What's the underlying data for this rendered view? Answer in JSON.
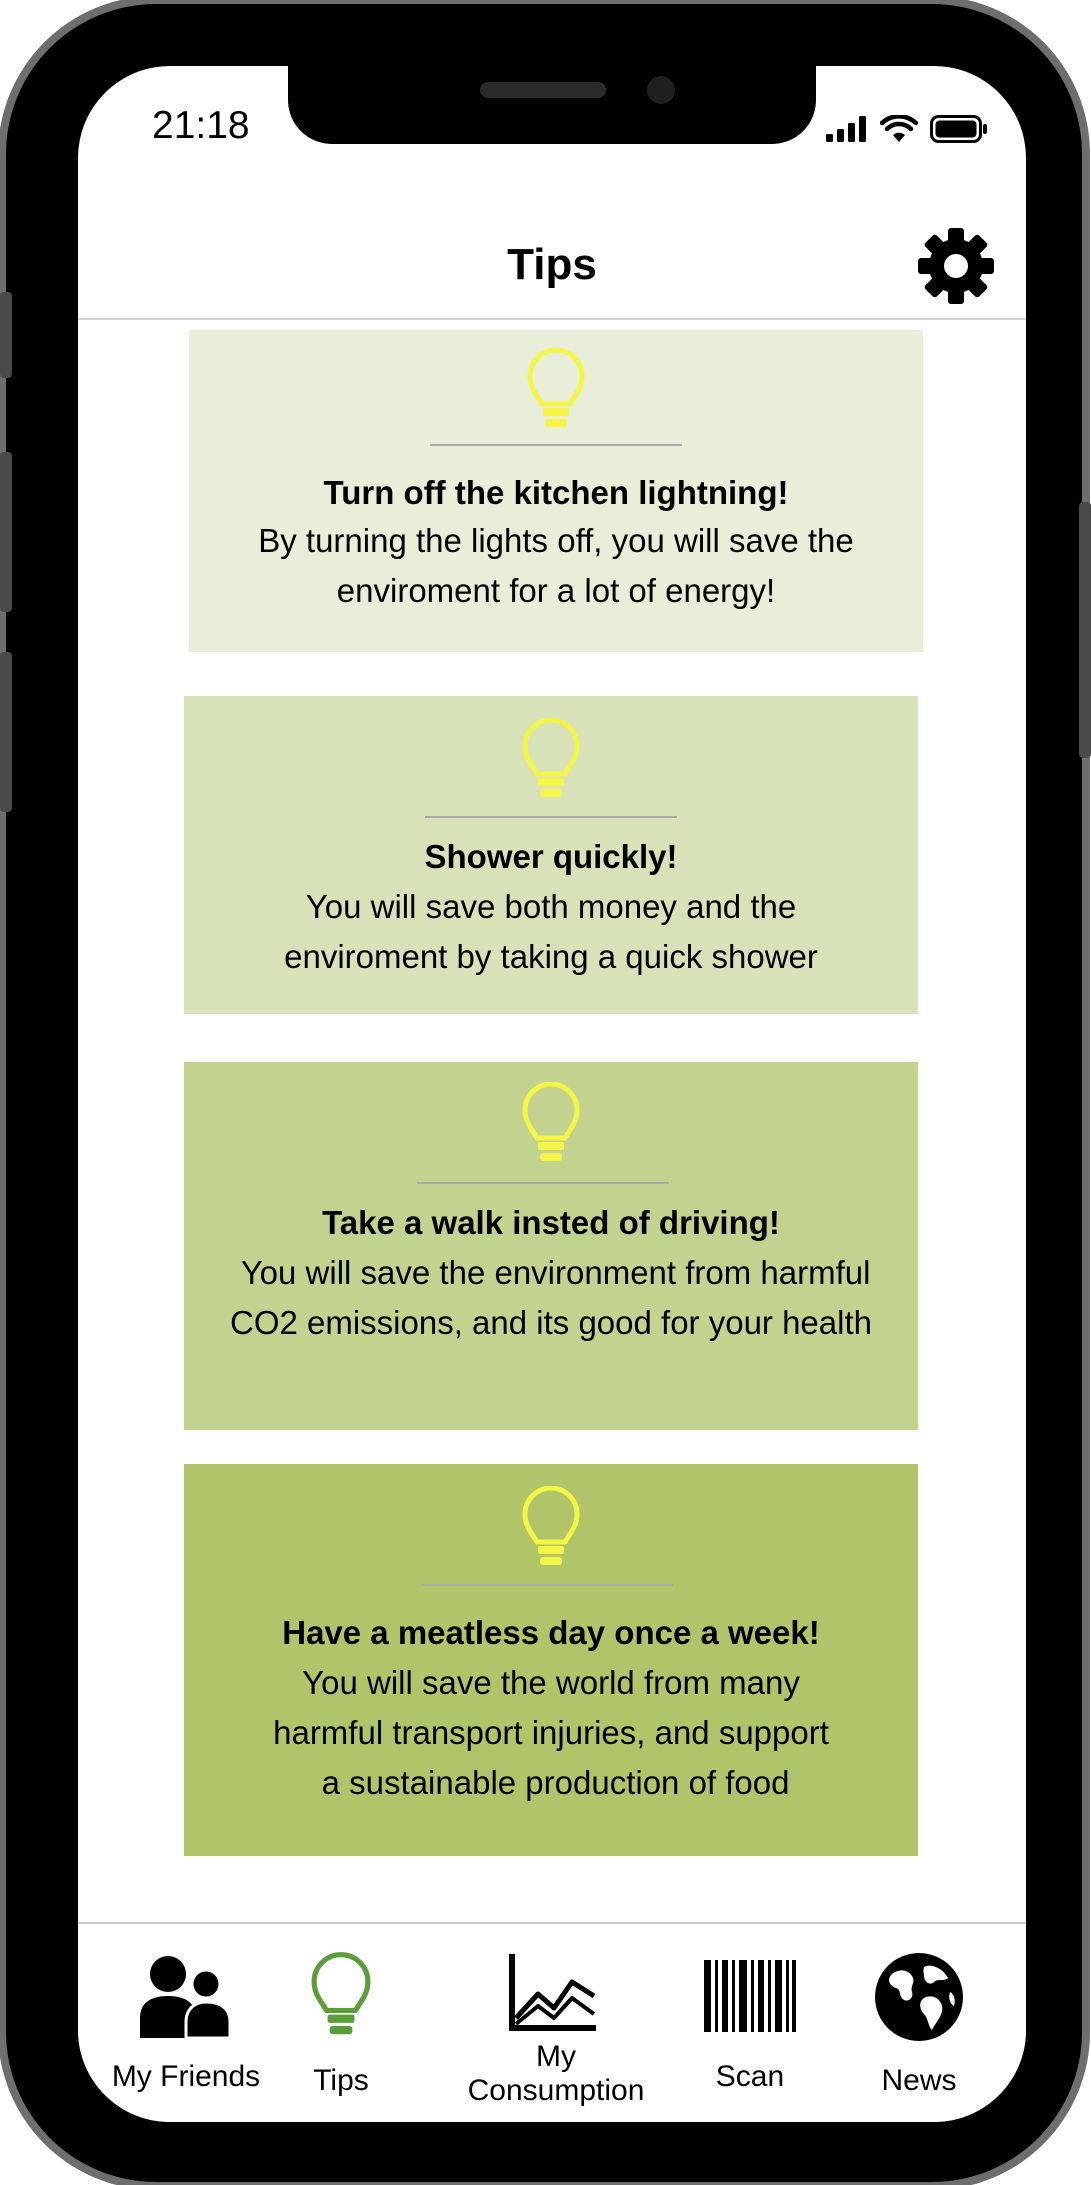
{
  "status_bar": {
    "time": "21:18"
  },
  "header": {
    "title": "Tips"
  },
  "colors": {
    "card_1": "#e8eed7",
    "card_2": "#d8e2b8",
    "card_3": "#c2d38f",
    "card_4": "#b0c46a",
    "bulb": "#f5f545",
    "tab_active": "#5a9e3a"
  },
  "tips": [
    {
      "title": "Turn off the kitchen lightning!",
      "body": "By turning the lights off, you will save the\nenviroment for a lot of energy!"
    },
    {
      "title": "Shower quickly!",
      "body": "You will save both money and the\nenviroment by taking a quick shower"
    },
    {
      "title": "Take a walk insted of driving!",
      "body": " You will save the environment from harmful\nCO2 emissions, and its good for your health"
    },
    {
      "title": "Have a meatless day once a week!",
      "body": "You will save the world from many\nharmful transport injuries, and support\n a sustainable production of food"
    }
  ],
  "tabbar": {
    "friends": "My Friends",
    "tips": "Tips",
    "consumption": "My\nConsumption",
    "scan": "Scan",
    "news": "News"
  },
  "icons": [
    "signal-icon",
    "wifi-icon",
    "battery-icon",
    "gear-icon",
    "lightbulb-icon",
    "people-icon",
    "chart-icon",
    "barcode-icon",
    "globe-icon"
  ]
}
